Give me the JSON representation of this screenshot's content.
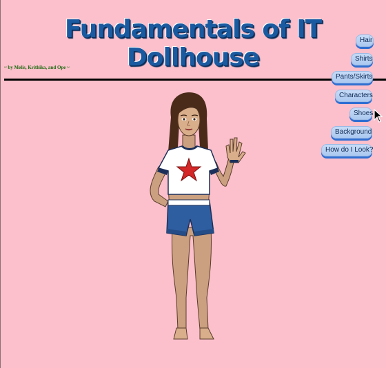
{
  "header": {
    "title": "Fundamentals of IT Dollhouse",
    "byline": "~ by Melis, Krithika, and Ope ~"
  },
  "nav": {
    "hair": "Hair",
    "shirts": "Shirts",
    "pants_skirts": "Pants/Skirts",
    "characters": "Characters",
    "shoes": "Shoes",
    "background": "Background",
    "how_do_i_look": "How do I Look?"
  },
  "colors": {
    "background": "#fbc0cb",
    "title": "#1a5aa0",
    "byline": "#1f6a10",
    "button": "#b6d0f2",
    "button_shadow": "#2f6fd2"
  },
  "icons": {
    "cursor": "mouse-pointer-icon"
  }
}
